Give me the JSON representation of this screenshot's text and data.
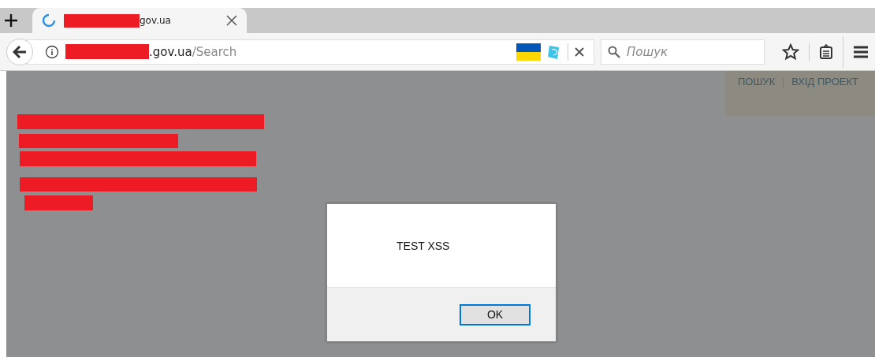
{
  "tab": {
    "title": "gov.ua",
    "loading": true
  },
  "address_bar": {
    "host": ".gov.ua",
    "path": "/Search"
  },
  "search": {
    "placeholder": "Пошук"
  },
  "site_nav": [
    "ПОШУК",
    "ВХІД ПРОЕКТ"
  ],
  "dialog": {
    "message": "TEST XSS",
    "button": "OK"
  }
}
